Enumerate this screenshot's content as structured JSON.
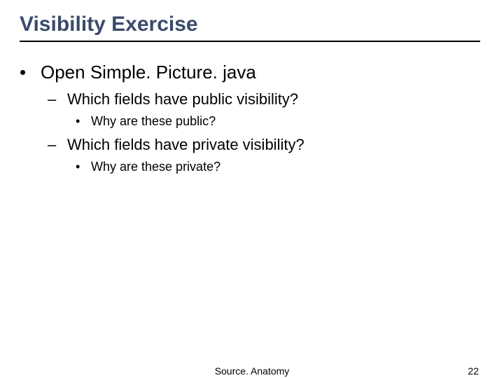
{
  "slide": {
    "title": "Visibility Exercise",
    "bullets": {
      "l1": "Open Simple. Picture. java",
      "l2a": "Which fields have public visibility?",
      "l3a": "Why are these public?",
      "l2b": "Which fields have private visibility?",
      "l3b": "Why are these private?"
    },
    "footer": {
      "center": "Source. Anatomy",
      "page": "22"
    }
  }
}
